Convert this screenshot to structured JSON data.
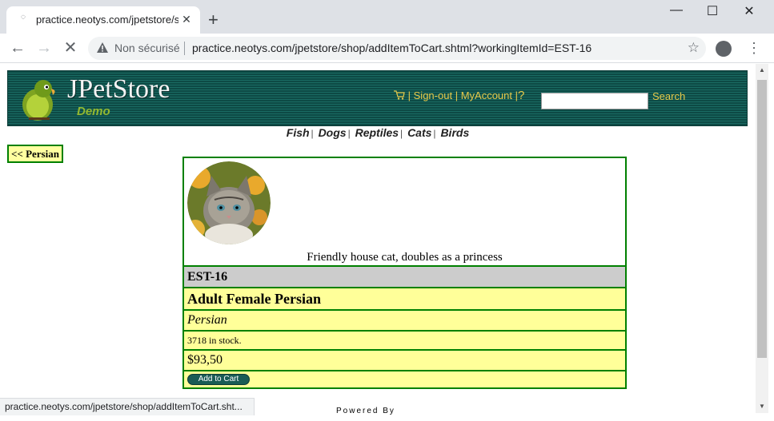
{
  "browser": {
    "tab_title": "practice.neotys.com/jpetstore/sh",
    "new_tab": "+",
    "security_label": "Non sécurisé",
    "url": "practice.neotys.com/jpetstore/shop/addItemToCart.shtml?workingItemId=EST-16",
    "status_url": "practice.neotys.com/jpetstore/shop/addItemToCart.sht..."
  },
  "header": {
    "logo": "JPetStore",
    "logo_sub": "Demo",
    "sign_out": "Sign-out",
    "my_account": "MyAccount",
    "help": "?",
    "search_value": "",
    "search_button": "Search"
  },
  "quicklinks": [
    "Fish",
    "Dogs",
    "Reptiles",
    "Cats",
    "Birds"
  ],
  "back_link": "<< Persian",
  "item": {
    "description": "Friendly house cat, doubles as a princess",
    "id": "EST-16",
    "name": "Adult Female Persian",
    "product": "Persian",
    "stock": "3718 in stock.",
    "price": "$93,50",
    "add_to_cart": "Add to Cart"
  },
  "footer": {
    "powered_by": "Powered By"
  },
  "colors": {
    "header_bg": "#0d4a45",
    "header_link": "#e7c94a",
    "table_border": "#008000",
    "row_yellow": "#ffff99",
    "row_grey": "#cccccc"
  },
  "icons": [
    "cart-icon",
    "warning-icon",
    "star-icon",
    "profile-icon",
    "menu-icon",
    "back-arrow-icon",
    "forward-arrow-icon",
    "stop-icon"
  ]
}
